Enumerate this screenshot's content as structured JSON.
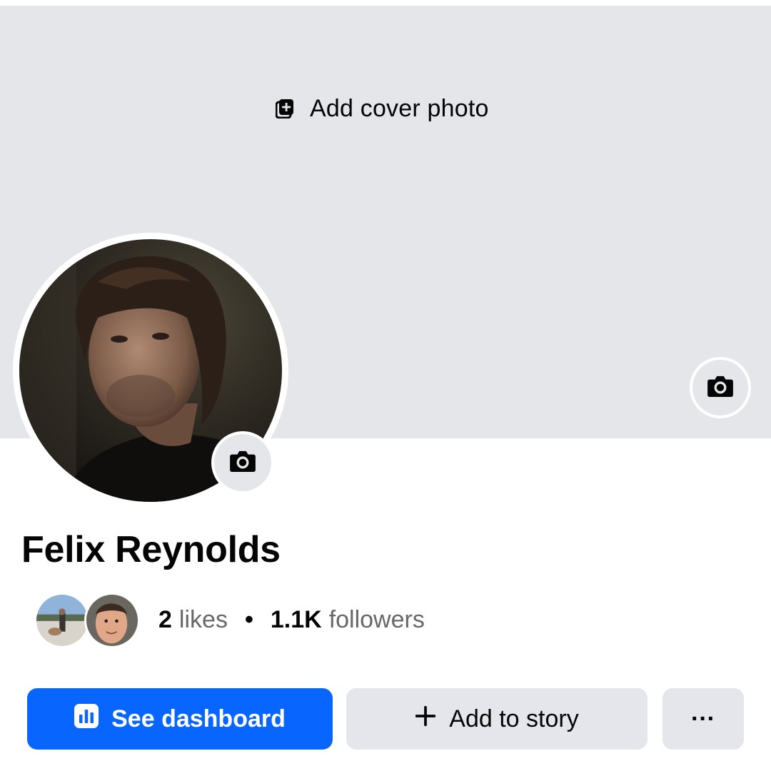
{
  "cover": {
    "add_cover_label": "Add cover photo",
    "add_cover_icon": "add-photo-icon",
    "camera_icon": "camera-icon"
  },
  "profile": {
    "name": "Felix Reynolds",
    "avatar_camera_icon": "camera-icon"
  },
  "stats": {
    "likes_count": "2",
    "likes_label": "likes",
    "separator": "•",
    "followers_count": "1.1K",
    "followers_label": "followers"
  },
  "actions": {
    "dashboard_label": "See dashboard",
    "dashboard_icon": "dashboard-chart-icon",
    "story_label": "Add to story",
    "story_icon": "plus-icon",
    "more_label": "···"
  },
  "colors": {
    "primary": "#0866ff",
    "secondary_button": "#e4e6eb",
    "cover_bg": "#e4e6e9",
    "muted_text": "#65676b"
  }
}
